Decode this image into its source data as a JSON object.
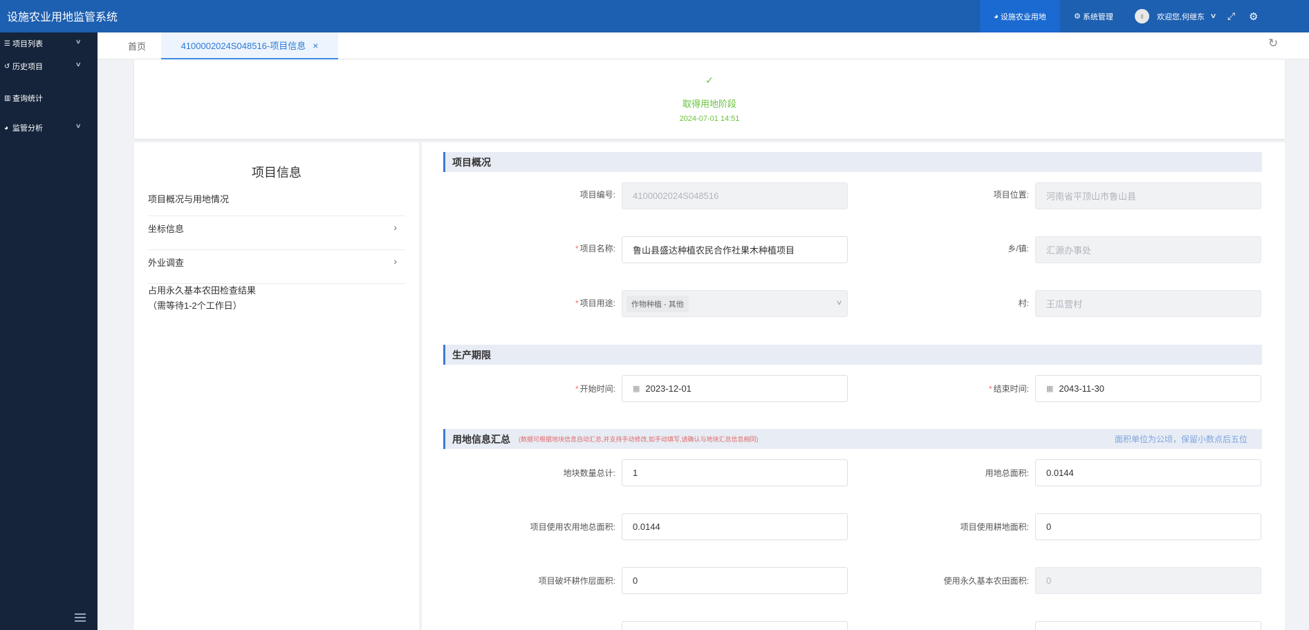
{
  "header": {
    "app_title": "设施农业用地监管系统",
    "nav_active_label": "设施农业用地",
    "nav_system_label": "系统管理",
    "avatar_text": "ll",
    "welcome_text": "欢迎您,何继东"
  },
  "sidebar": {
    "items": [
      {
        "label": "项目列表",
        "icon": "list-icon",
        "has_children": true
      },
      {
        "label": "历史项目",
        "icon": "history-icon",
        "has_children": true
      },
      {
        "label": "查询统计",
        "icon": "bar-chart-icon",
        "has_children": false
      },
      {
        "label": "监管分析",
        "icon": "pie-chart-icon",
        "has_children": true
      }
    ]
  },
  "tabs": {
    "home_label": "首页",
    "active_label": "4100002024S048516-项目信息"
  },
  "status": {
    "stage_label": "取得用地阶段",
    "stage_time": "2024-07-01 14:51",
    "color": "#67c23a"
  },
  "info_panel": {
    "title": "项目信息",
    "items": [
      {
        "label": "项目概况与用地情况",
        "has_arrow": false
      },
      {
        "label": "坐标信息",
        "has_arrow": true
      },
      {
        "label": "外业调查",
        "has_arrow": true
      },
      {
        "label": "占用永久基本农田检查结果",
        "sub_label": "（需等待1-2个工作日）",
        "has_arrow": false
      }
    ]
  },
  "form": {
    "section_overview": {
      "title": "项目概况",
      "project_no_label": "项目编号:",
      "project_no_value": "4100002024S048516",
      "location_label": "项目位置:",
      "location_value": "河南省平顶山市鲁山县",
      "name_label": "项目名称:",
      "name_value": "鲁山县盛达种植农民合作社果木种植项目",
      "town_label": "乡/镇:",
      "town_value": "汇源办事处",
      "usage_label": "项目用途:",
      "usage_value": "作物种植 - 其他",
      "village_label": "村:",
      "village_value": "王瓜营村"
    },
    "section_period": {
      "title": "生产期限",
      "start_label": "开始时间:",
      "start_value": "2023-12-01",
      "end_label": "结束时间:",
      "end_value": "2043-11-30"
    },
    "section_land": {
      "title": "用地信息汇总",
      "note": "(数据可根据地块信息自动汇总,并支持手动修改,如手动填写,请确认与地块汇总信息相同)",
      "unit_note": "面积单位为公顷，保留小数点后五位",
      "parcel_count_label": "地块数量总计:",
      "parcel_count_value": "1",
      "total_area_label": "用地总面积:",
      "total_area_value": "0.0144",
      "farm_area_label": "项目使用农用地总面积:",
      "farm_area_value": "0.0144",
      "cultivated_area_label": "项目使用耕地面积:",
      "cultivated_area_value": "0",
      "damaged_area_label": "项目破坏耕作层面积:",
      "damaged_area_value": "0",
      "basic_farmland_label": "使用永久基本农田面积:",
      "basic_farmland_value": "0"
    }
  }
}
